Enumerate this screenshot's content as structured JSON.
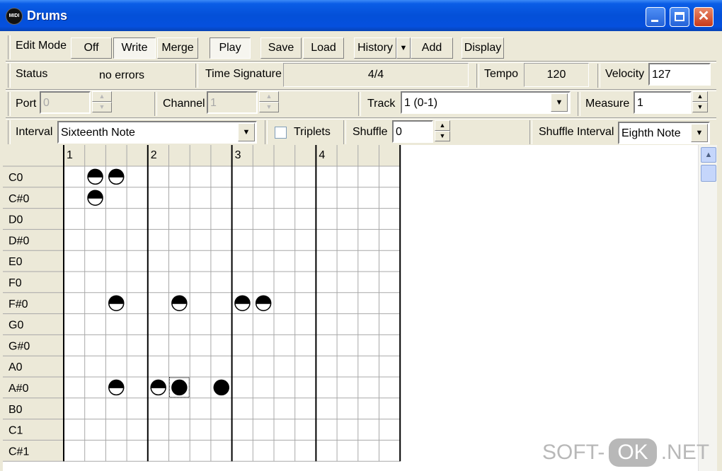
{
  "window": {
    "title": "Drums",
    "app_icon_text": "MIDI"
  },
  "toolbar": {
    "edit_mode_label": "Edit Mode",
    "off": "Off",
    "write": "Write",
    "merge": "Merge",
    "play": "Play",
    "save": "Save",
    "load": "Load",
    "history": "History",
    "add": "Add",
    "display": "Display"
  },
  "status": {
    "status_label": "Status",
    "status_value": "no errors",
    "time_sig_label": "Time Signature",
    "time_sig_value": "4/4",
    "tempo_label": "Tempo",
    "tempo_value": "120",
    "velocity_label": "Velocity",
    "velocity_value": "127"
  },
  "row3": {
    "port_label": "Port",
    "port_value": "0",
    "channel_label": "Channel",
    "channel_value": "1",
    "track_label": "Track",
    "track_value": "1 (0-1)",
    "measure_label": "Measure",
    "measure_value": "1"
  },
  "row4": {
    "interval_label": "Interval",
    "interval_value": "Sixteenth Note",
    "triplets_label": "Triplets",
    "triplets_checked": false,
    "shuffle_label": "Shuffle",
    "shuffle_value": "0",
    "shuffle_interval_label": "Shuffle Interval",
    "shuffle_interval_value": "Eighth Note"
  },
  "grid": {
    "beats": [
      "1",
      "2",
      "3",
      "4"
    ],
    "steps_per_beat": 4,
    "notes": [
      "C0",
      "C#0",
      "D0",
      "D#0",
      "E0",
      "F0",
      "F#0",
      "G0",
      "G#0",
      "A0",
      "A#0",
      "B0",
      "C1",
      "C#1"
    ],
    "events": [
      {
        "note": "C0",
        "step": 1,
        "style": "half-top"
      },
      {
        "note": "C0",
        "step": 2,
        "style": "half-bottom"
      },
      {
        "note": "C#0",
        "step": 1,
        "style": "half-bottom"
      },
      {
        "note": "F#0",
        "step": 2,
        "style": "half-top"
      },
      {
        "note": "F#0",
        "step": 5,
        "style": "half-bottom"
      },
      {
        "note": "F#0",
        "step": 8,
        "style": "half-bottom"
      },
      {
        "note": "F#0",
        "step": 9,
        "style": "half-bottom"
      },
      {
        "note": "A#0",
        "step": 2,
        "style": "half-bottom"
      },
      {
        "note": "A#0",
        "step": 4,
        "style": "half-bottom"
      },
      {
        "note": "A#0",
        "step": 5,
        "style": "full",
        "selected": true
      },
      {
        "note": "A#0",
        "step": 7,
        "style": "full"
      }
    ]
  },
  "watermark": {
    "left": "SOFT-",
    "ok": "OK",
    "right": ".NET"
  }
}
